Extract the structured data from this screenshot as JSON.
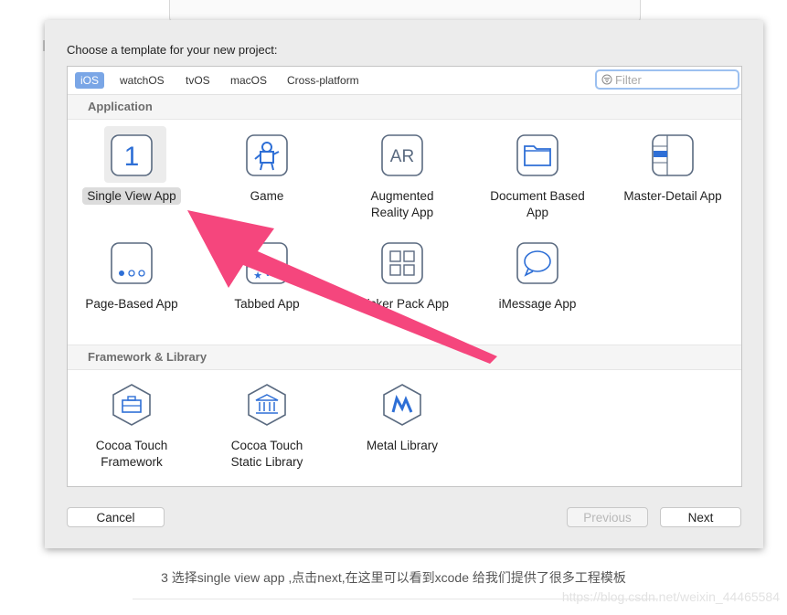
{
  "dialog": {
    "title": "Choose a template for your new project:",
    "filter_placeholder": "Filter"
  },
  "platform_tabs": [
    "iOS",
    "watchOS",
    "tvOS",
    "macOS",
    "Cross-platform"
  ],
  "selected_platform": "iOS",
  "sections": {
    "application": "Application",
    "framework": "Framework & Library"
  },
  "application_items": [
    {
      "label": "Single View App",
      "icon": "single-view-icon",
      "selected": true
    },
    {
      "label": "Game",
      "icon": "game-icon"
    },
    {
      "label": "Augmented Reality App",
      "icon": "ar-icon"
    },
    {
      "label": "Document Based App",
      "icon": "document-icon"
    },
    {
      "label": "Master-Detail App",
      "icon": "master-detail-icon"
    },
    {
      "label": "Page-Based App",
      "icon": "page-based-icon"
    },
    {
      "label": "Tabbed App",
      "icon": "tabbed-icon"
    },
    {
      "label": "Sticker Pack App",
      "icon": "sticker-pack-icon"
    },
    {
      "label": "iMessage App",
      "icon": "imessage-icon"
    }
  ],
  "framework_items": [
    {
      "label": "Cocoa Touch Framework",
      "icon": "cocoa-framework-icon"
    },
    {
      "label": "Cocoa Touch Static Library",
      "icon": "static-library-icon"
    },
    {
      "label": "Metal Library",
      "icon": "metal-icon"
    }
  ],
  "buttons": {
    "cancel": "Cancel",
    "previous": "Previous",
    "next": "Next"
  },
  "colors": {
    "accent": "#7aa6e6",
    "arrow": "#f5467d"
  },
  "caption": "3 选择single view app ,点击next,在这里可以看到xcode 给我们提供了很多工程模板",
  "watermark": "https://blog.csdn.net/weixin_44465584"
}
